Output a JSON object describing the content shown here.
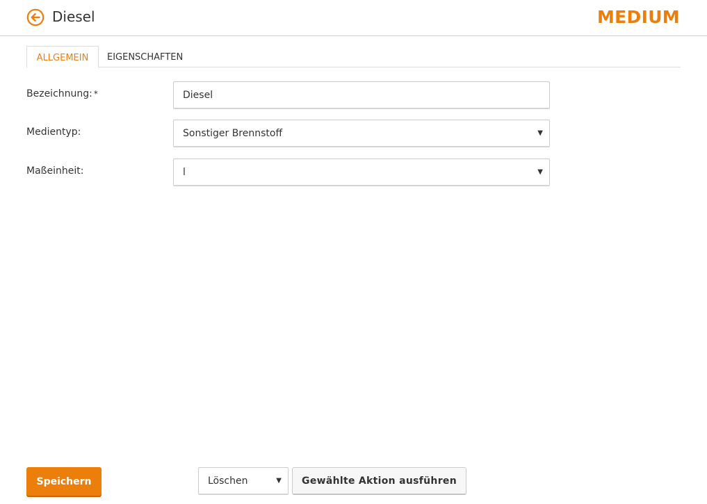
{
  "colors": {
    "accent": "#ec7f0b",
    "text": "#333333",
    "border": "#cccccc"
  },
  "header": {
    "back_icon": "arrow-left-circle-icon",
    "title": "Diesel",
    "entity_type": "MEDIUM"
  },
  "tabs": [
    {
      "label": "ALLGEMEIN",
      "active": true
    },
    {
      "label": "EIGENSCHAFTEN",
      "active": false
    }
  ],
  "form": {
    "bezeichnung": {
      "label": "Bezeichnung:",
      "required_mark": "*",
      "value": "Diesel"
    },
    "medientyp": {
      "label": "Medientyp:",
      "value": "Sonstiger Brennstoff"
    },
    "masseinheit": {
      "label": "Maßeinheit:",
      "value": "l"
    }
  },
  "footer": {
    "save_label": "Speichern",
    "action_select_value": "Löschen",
    "execute_label": "Gewählte Aktion ausführen"
  }
}
